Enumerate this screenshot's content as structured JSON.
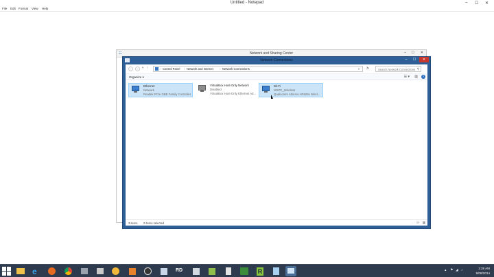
{
  "notepad": {
    "title": "Untitled - Notepad",
    "menu": [
      "File",
      "Edit",
      "Format",
      "View",
      "Help"
    ],
    "controls": {
      "minimize": "–",
      "maximize": "☐",
      "close": "✕"
    }
  },
  "nsc": {
    "title": "Network and Sharing Center"
  },
  "nc": {
    "title": "Network Connections",
    "breadcrumbs": [
      "Control Panel",
      "Network and Internet",
      "Network Connections"
    ],
    "search_placeholder": "Search Network Connections",
    "organize": "Organize",
    "items": [
      {
        "name": "Ethernet",
        "status": "Network",
        "device": "Realtek PCIe GBE Family Controller",
        "icon": "network-monitor-icon"
      },
      {
        "name": "VirtualBox Host-Only Network",
        "status": "Disabled",
        "device": "VirtualBox Host-Only Ethernet Ad...",
        "icon": "network-monitor-disabled-icon"
      },
      {
        "name": "Wi-Fi",
        "status": "MSPC_Wireless",
        "device": "Qualcomm Atheros AR928x Wirel...",
        "icon": "wifi-monitor-icon"
      }
    ],
    "status_bar": {
      "count": "3 items",
      "selected": "2 items selected"
    }
  },
  "taskbar": {
    "apps": [
      "file-explorer-icon",
      "internet-explorer-icon",
      "firefox-icon",
      "chrome-icon",
      "tool-icon",
      "media-player-icon",
      "video-icon",
      "onenote-icon",
      "game-icon",
      "paint-icon",
      "remote-desktop-icon",
      "generic-app-icon",
      "calculator-icon",
      "network-icon",
      "r-app-icon",
      "notepad-icon",
      "network-connections-icon"
    ],
    "remote_desktop_label": "RD",
    "r_label": "R",
    "clock_time": "1:28 AM",
    "clock_date": "6/08/2014"
  },
  "colors": {
    "accent_window": "#2f5f97",
    "selection": "#cce4f7",
    "taskbar": "#2e3a4d"
  }
}
